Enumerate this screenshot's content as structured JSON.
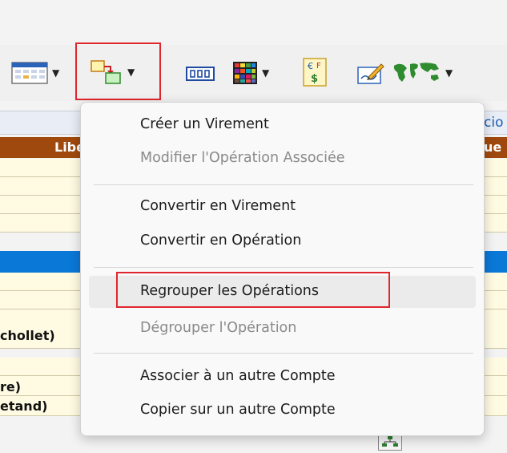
{
  "toolbar": {
    "buttons": [
      {
        "name": "calendar-icon",
        "has_dropdown": true
      },
      {
        "name": "transfer-icon",
        "has_dropdown": true,
        "highlighted": true
      },
      {
        "name": "number-format-icon",
        "has_dropdown": false
      },
      {
        "name": "color-grid-icon",
        "has_dropdown": true
      },
      {
        "name": "currency-convert-icon",
        "has_dropdown": false
      },
      {
        "name": "edit-check-icon",
        "has_dropdown": false
      },
      {
        "name": "world-map-icon",
        "has_dropdown": true
      }
    ],
    "highlight_color": "#e0262d"
  },
  "background": {
    "tab_partial": "cio",
    "header_left": "Libell",
    "header_right": "ue",
    "row_texts": [
      "chollet)",
      "re)",
      "etand)"
    ],
    "selected_row_color": "#0a78d7",
    "header_color": "#a0490e"
  },
  "menu": {
    "items": [
      {
        "label": "Créer un Virement",
        "enabled": true
      },
      {
        "label": "Modifier l'Opération Associée",
        "enabled": false
      },
      {
        "label": "Convertir en Virement",
        "enabled": true
      },
      {
        "label": "Convertir en Opération",
        "enabled": true
      },
      {
        "label": "Regrouper les Opérations",
        "enabled": true,
        "hovered": true,
        "highlighted": true
      },
      {
        "label": "Dégrouper l'Opération",
        "enabled": false
      },
      {
        "label": "Associer à un autre Compte",
        "enabled": true
      },
      {
        "label": "Copier sur un autre Compte",
        "enabled": true
      }
    ]
  }
}
